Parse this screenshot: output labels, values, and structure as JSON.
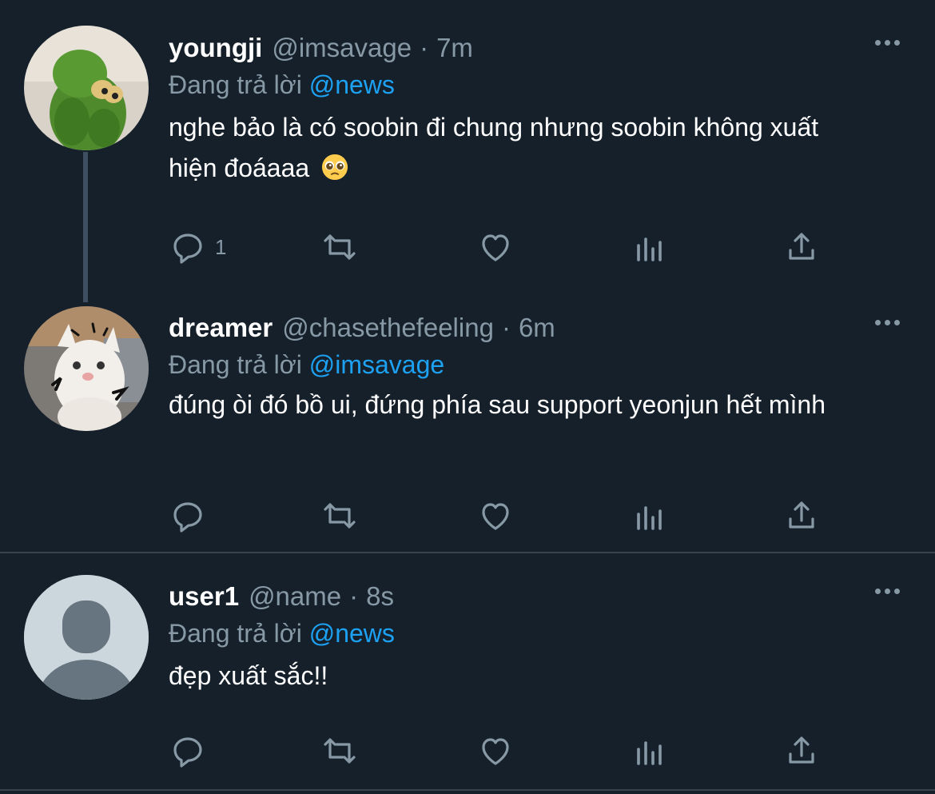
{
  "theme": {
    "background": "#15202b",
    "muted": "#8899a6",
    "link": "#1da1f2",
    "divider": "#38444d"
  },
  "tweets": [
    {
      "name": "youngji",
      "handle": "@imsavage",
      "separator": "·",
      "time": "7m",
      "reply_prefix": "Đang trả lời",
      "reply_to": "@news",
      "text": "nghe bảo là có soobin đi chung nhưng soobin không xuất hiện đoáaaa",
      "emoji": "pleading-face-emoji",
      "avatar": "green-frog-plush-avatar",
      "counts": {
        "reply": "1",
        "retweet": "",
        "like": ""
      }
    },
    {
      "name": "dreamer",
      "handle": "@chasethefeeling",
      "separator": "·",
      "time": "6m",
      "reply_prefix": "Đang trả lời",
      "reply_to": "@imsavage",
      "text": "đúng òi đó bồ ui, đứng phía sau support yeonjun hết mình",
      "avatar": "white-kitten-avatar",
      "counts": {
        "reply": "",
        "retweet": "",
        "like": ""
      }
    },
    {
      "name": "user1",
      "handle": "@name",
      "separator": "·",
      "time": "8s",
      "reply_prefix": "Đang trả lời",
      "reply_to": "@news",
      "text": "đẹp xuất sắc!!",
      "avatar": "default-profile-avatar",
      "counts": {
        "reply": "",
        "retweet": "",
        "like": ""
      }
    }
  ],
  "icons": [
    "reply-icon",
    "retweet-icon",
    "like-icon",
    "analytics-icon",
    "share-icon",
    "more-icon"
  ]
}
